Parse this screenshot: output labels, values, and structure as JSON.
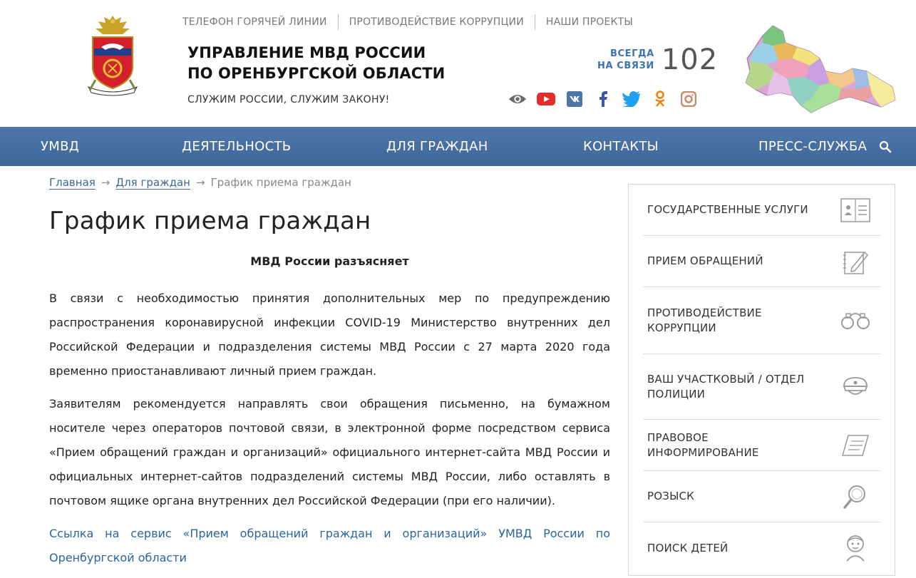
{
  "header": {
    "top_links": [
      "ТЕЛЕФОН ГОРЯЧЕЙ ЛИНИИ",
      "ПРОТИВОДЕЙСТВИЕ КОРРУПЦИИ",
      "НАШИ ПРОЕКТЫ"
    ],
    "title_line1": "УПРАВЛЕНИЕ МВД РОССИИ",
    "title_line2": "ПО ОРЕНБУРГСКОЙ ОБЛАСТИ",
    "slogan": "СЛУЖИМ РОССИИ, СЛУЖИМ ЗАКОНУ!",
    "hotline_label_line1": "ВСЕГДА",
    "hotline_label_line2": "НА СВЯЗИ",
    "hotline_number": "102",
    "socials": [
      "eye-icon",
      "youtube-icon",
      "vk-icon",
      "facebook-icon",
      "twitter-icon",
      "odnoklassniki-icon",
      "instagram-icon"
    ]
  },
  "nav": {
    "items": [
      "УМВД",
      "ДЕЯТЕЛЬНОСТЬ",
      "ДЛЯ ГРАЖДАН",
      "КОНТАКТЫ",
      "ПРЕСС-СЛУЖБА"
    ]
  },
  "breadcrumb": {
    "home": "Главная",
    "section": "Для граждан",
    "current": "График приема граждан",
    "separator": "→"
  },
  "page": {
    "title": "График приема граждан",
    "subtitle": "МВД России разъясняет",
    "paragraph1": "В связи с необходимостью принятия дополнительных мер по предупреждению распространения коронавирусной инфекции COVID-19 Министерство внутренних дел Российской Федерации и подразделения системы МВД России с 27 марта 2020 года временно приостанавливают личный прием граждан.",
    "paragraph2": "Заявителям рекомендуется направлять свои обращения письменно, на бумажном носителе через операторов почтовой связи, в электронной форме посредством сервиса «Прием обращений граждан и организаций» официального интернет-сайта МВД России и официальных интернет-сайтов подразделений системы МВД России, либо оставлять в почтовом ящике органа внутренних дел Российской Федерации (при его наличии).",
    "link": "Ссылка на сервис «Прием обращений граждан и организаций» УМВД России по Оренбургской области"
  },
  "sidebar": {
    "items": [
      {
        "label": "ГОСУДАРСТВЕННЫЕ УСЛУГИ",
        "icon": "id-card-icon"
      },
      {
        "label": "ПРИЕМ ОБРАЩЕНИЙ",
        "icon": "pencil-notepad-icon"
      },
      {
        "label": "ПРОТИВОДЕЙСТВИЕ КОРРУПЦИИ",
        "icon": "handcuffs-icon"
      },
      {
        "label": "ВАШ УЧАСТКОВЫЙ / ОТДЕЛ ПОЛИЦИИ",
        "icon": "police-cap-icon"
      },
      {
        "label": "ПРАВОВОЕ ИНФОРМИРОВАНИЕ",
        "icon": "document-icon"
      },
      {
        "label": "РОЗЫСК",
        "icon": "magnifier-icon"
      },
      {
        "label": "ПОИСК ДЕТЕЙ",
        "icon": "child-icon"
      }
    ]
  },
  "colors": {
    "nav_bg": "#456d9f",
    "link": "#2a64a0",
    "hotline_label": "#3a73b3",
    "youtube": "#e52d27",
    "vk": "#4a76a8",
    "facebook": "#3b5998",
    "twitter": "#1da1f2",
    "odnoklassniki": "#ee8208",
    "instagram": "#c98a6a"
  }
}
